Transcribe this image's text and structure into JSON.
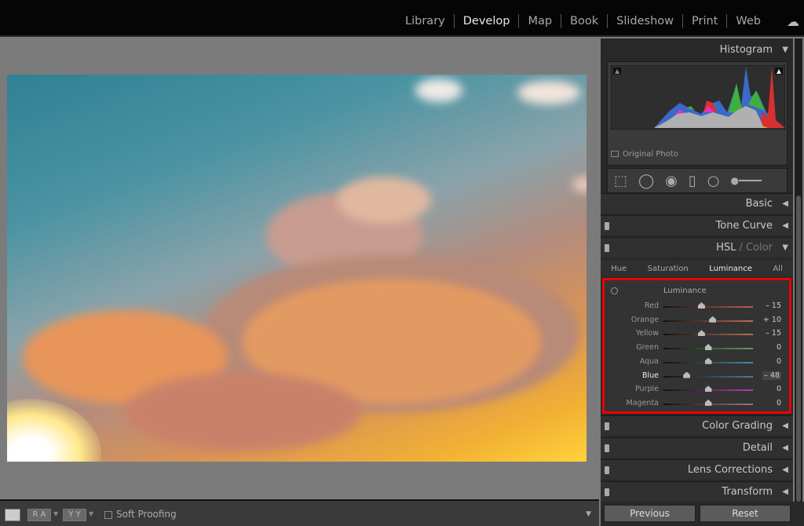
{
  "nav": {
    "items": [
      "Library",
      "Develop",
      "Map",
      "Book",
      "Slideshow",
      "Print",
      "Web"
    ],
    "active": "Develop"
  },
  "panels": {
    "histogram": "Histogram",
    "original_photo": "Original Photo",
    "basic": "Basic",
    "tone_curve": "Tone Curve",
    "hsl": "HSL",
    "hsl_sep": " / ",
    "color": "Color",
    "color_grading": "Color Grading",
    "detail": "Detail",
    "lens_corrections": "Lens Corrections",
    "transform": "Transform"
  },
  "hsl_tabs": [
    "Hue",
    "Saturation",
    "Luminance",
    "All"
  ],
  "hsl_active_tab": "Luminance",
  "luminance": {
    "title": "Luminance",
    "sliders": [
      {
        "label": "Red",
        "value": -15,
        "display": "– 15",
        "color": "#c0604a"
      },
      {
        "label": "Orange",
        "value": 10,
        "display": "+ 10",
        "color": "#c07050"
      },
      {
        "label": "Yellow",
        "value": -15,
        "display": "– 15",
        "color": "#b07050"
      },
      {
        "label": "Green",
        "value": 0,
        "display": "0",
        "color": "#5aa050"
      },
      {
        "label": "Aqua",
        "value": 0,
        "display": "0",
        "color": "#4a8aa0"
      },
      {
        "label": "Blue",
        "value": -48,
        "display": "– 48",
        "color": "#4a7aa0"
      },
      {
        "label": "Purple",
        "value": 0,
        "display": "0",
        "color": "#b040b0"
      },
      {
        "label": "Magenta",
        "value": 0,
        "display": "0",
        "color": "#a07080"
      }
    ]
  },
  "toolbar": {
    "soft_proofing": "Soft Proofing",
    "ra": "R A",
    "yy": "Y Y"
  },
  "buttons": {
    "previous": "Previous",
    "reset": "Reset"
  }
}
